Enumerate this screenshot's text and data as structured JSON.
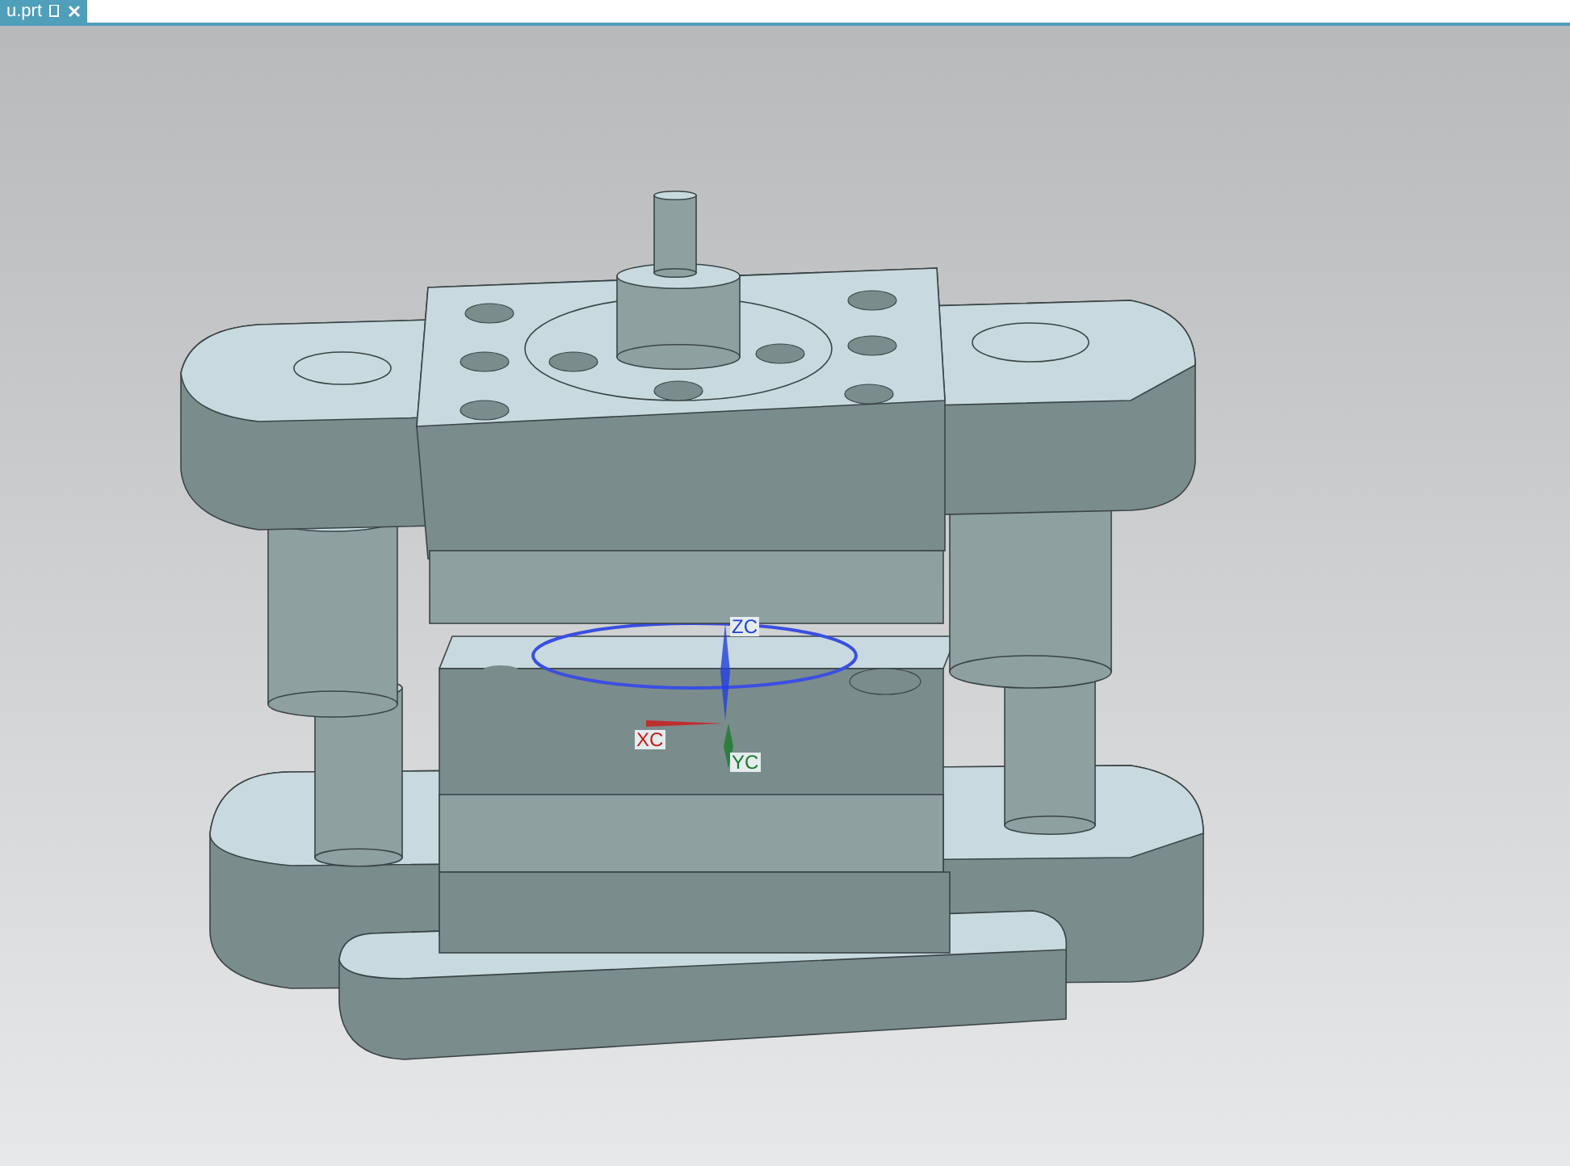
{
  "tabs": [
    {
      "label": "u.prt",
      "selected": true
    }
  ],
  "axes": [
    {
      "kind": "z",
      "label": "ZC",
      "color": "#2040e0"
    },
    {
      "kind": "x",
      "label": "XC",
      "color": "#d01818"
    },
    {
      "kind": "y",
      "label": "YC",
      "color": "#1a7a2a"
    }
  ]
}
